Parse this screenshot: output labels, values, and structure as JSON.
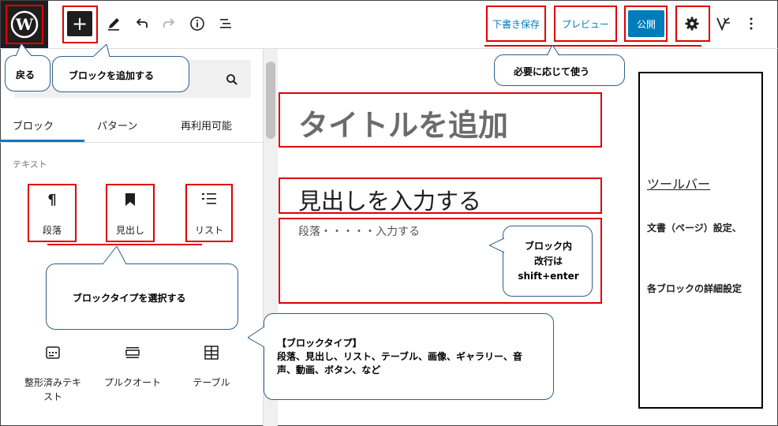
{
  "toolbar": {
    "save_draft_label": "下書き保存",
    "preview_label": "プレビュー",
    "publish_label": "公開"
  },
  "inserter": {
    "tabs": [
      "ブロック",
      "パターン",
      "再利用可能"
    ],
    "category_text": "テキスト",
    "blocks": [
      {
        "label": "段落",
        "icon": "paragraph-icon"
      },
      {
        "label": "見出し",
        "icon": "bookmark-icon"
      },
      {
        "label": "リスト",
        "icon": "list-icon"
      }
    ],
    "more_blocks": [
      {
        "label": "整形済みテキ\nスト",
        "icon": "preformatted-icon"
      },
      {
        "label": "プルクオート",
        "icon": "pullquote-icon"
      },
      {
        "label": "テーブル",
        "icon": "table-icon"
      }
    ]
  },
  "editor": {
    "title_placeholder": "タイトルを追加",
    "heading_text": "見出しを入力する",
    "paragraph_text": "段落・・・・・入力する"
  },
  "annotations": {
    "back": "戻る",
    "add_block": "ブロックを追加する",
    "use_as_needed": "必要に応じて使う",
    "select_block_type": "ブロックタイプを選択する",
    "block_types_title": "【ブロックタイプ】",
    "block_types_body": "段落、見出し、リスト、テーブル、画像、ギャラリー、音声、動画、ボタン、など",
    "linebreak_note": "ブロック内\n改行は\nshift+enter",
    "toolbar_panel_title": "ツールバー",
    "toolbar_panel_line1": "文書（ページ）設定、",
    "toolbar_panel_line2": "各ブロックの詳細設定"
  },
  "colors": {
    "accent": "#007cba",
    "annotation_red": "#e00000",
    "wp_logo_bg": "#1e1e1e"
  }
}
